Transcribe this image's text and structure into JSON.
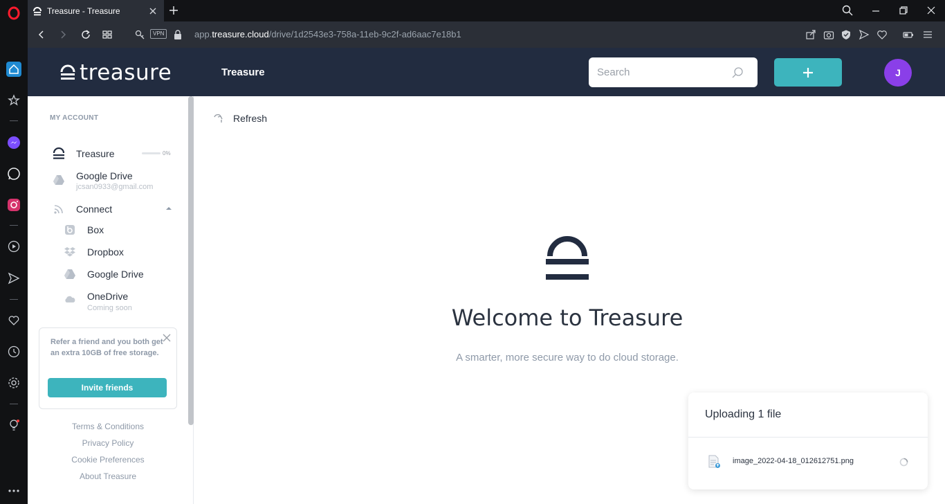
{
  "browser": {
    "tab_title": "Treasure - Treasure",
    "url_prefix": "app.",
    "url_domain": "treasure.cloud",
    "url_path": "/drive/1d2543e3-758a-11eb-9c2f-ad6aac7e18b1",
    "vpn_label": "VPN"
  },
  "header": {
    "logo_text": "treasure",
    "title": "Treasure",
    "search_placeholder": "Search",
    "avatar_initial": "J"
  },
  "sidebar": {
    "section_label": "MY ACCOUNT",
    "treasure_label": "Treasure",
    "storage_percent": "0%",
    "google_drive_label": "Google Drive",
    "google_drive_email": "jcsan0933@gmail.com",
    "connect_label": "Connect",
    "connect_items": [
      {
        "label": "Box"
      },
      {
        "label": "Dropbox"
      },
      {
        "label": "Google Drive"
      },
      {
        "label": "OneDrive",
        "sub": "Coming soon"
      }
    ],
    "promo_text": "Refer a friend and you both get an extra 10GB of free storage.",
    "invite_label": "Invite friends",
    "footer_links": [
      "Terms & Conditions",
      "Privacy Policy",
      "Cookie Preferences",
      "About Treasure"
    ]
  },
  "main": {
    "refresh_label": "Refresh",
    "welcome_title": "Welcome to Treasure",
    "welcome_subtitle": "A smarter, more secure way to do cloud storage."
  },
  "upload": {
    "title": "Uploading 1 file",
    "file_name": "image_2022-04-18_012612751.png"
  },
  "colors": {
    "header_bg": "#222c40",
    "accent": "#3db4bd",
    "avatar": "#8a3fe8"
  }
}
